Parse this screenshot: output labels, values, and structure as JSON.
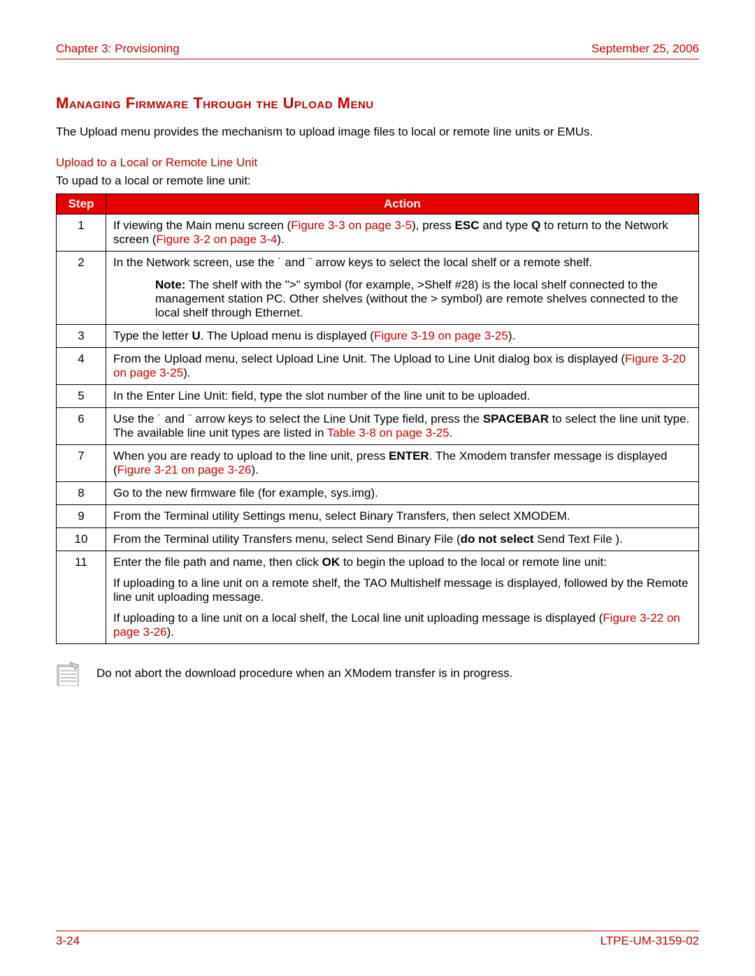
{
  "header": {
    "chapter": "Chapter 3: Provisioning",
    "date": "September 25, 2006"
  },
  "section_title": "Managing Firmware Through the Upload Menu",
  "intro": "The Upload menu provides the mechanism to upload image files to local or remote line units or EMUs.",
  "subhead": "Upload to a Local or Remote Line Unit",
  "sub_intro": "To upad to a local or remote line unit:",
  "table": {
    "head_step": "Step",
    "head_action": "Action",
    "rows": {
      "r1": {
        "num": "1",
        "t1": "If viewing the Main menu screen (",
        "l1": "Figure 3-3 on page 3-5",
        "t2": "), press ",
        "b1": "ESC",
        "t3": " and type ",
        "b2": "Q",
        "t4": " to return to the Network screen (",
        "l2": "Figure 3-2 on page 3-4",
        "t5": ")."
      },
      "r2": {
        "num": "2",
        "t1": "In the Network screen, use the   ˙  and  ¨  arrow keys to select the local shelf or a remote shelf.",
        "note_b": "Note:",
        "note_t": " The shelf with the \">\" symbol (for example, >Shelf #28) is the local shelf connected to the management station PC.  Other shelves (without the > symbol) are remote shelves connected to the local shelf through Ethernet."
      },
      "r3": {
        "num": "3",
        "t1": "Type the letter ",
        "b1": "U",
        "t2": ". The Upload menu is displayed (",
        "l1": "Figure 3-19 on page 3-25",
        "t3": ")."
      },
      "r4": {
        "num": "4",
        "t1": "From the Upload menu, select Upload Line Unit. The Upload to Line Unit dialog box is displayed (",
        "l1": "Figure 3-20 on page 3-25",
        "t2": ")."
      },
      "r5": {
        "num": "5",
        "t1": "In the Enter Line Unit: field, type the slot number of the line unit to be uploaded."
      },
      "r6": {
        "num": "6",
        "t1": "Use the  ˙  and  ¨  arrow keys to select the Line Unit Type field, press the ",
        "b1": "SPACEBAR",
        "t2": " to select the line unit type. The available line unit types are listed in ",
        "l1": "Table 3-8 on page 3-25",
        "t3": "."
      },
      "r7": {
        "num": "7",
        "t1": "When you are ready to upload to the line unit, press ",
        "b1": "ENTER",
        "t2": ". The Xmodem transfer message is displayed (",
        "l1": "Figure 3-21 on page 3-26",
        "t3": ")."
      },
      "r8": {
        "num": "8",
        "t1": "Go to the new firmware file (for example, sys.img)."
      },
      "r9": {
        "num": "9",
        "t1": "From the Terminal utility Settings menu, select Binary Transfers, then select XMODEM."
      },
      "r10": {
        "num": "10",
        "t1": "From the Terminal utility Transfers menu, select Send Binary File (",
        "b1": "do not select",
        "t2": " Send Text File )."
      },
      "r11": {
        "num": "11",
        "p1a": "Enter the file path and name, then click ",
        "p1b": "OK",
        "p1c": " to begin the upload to the local or remote line unit:",
        "p2": "If uploading to a line unit on a remote shelf, the TAO Multishelf message is displayed, followed by the Remote line unit uploading message.",
        "p3a": "If uploading to a line unit on a local shelf, the Local line unit uploading message is displayed (",
        "p3l": "Figure 3-22 on page 3-26",
        "p3b": ")."
      }
    }
  },
  "note_box": "Do not abort the download procedure when an XModem transfer is in progress.",
  "footer": {
    "page": "3-24",
    "doc": "LTPE-UM-3159-02"
  }
}
